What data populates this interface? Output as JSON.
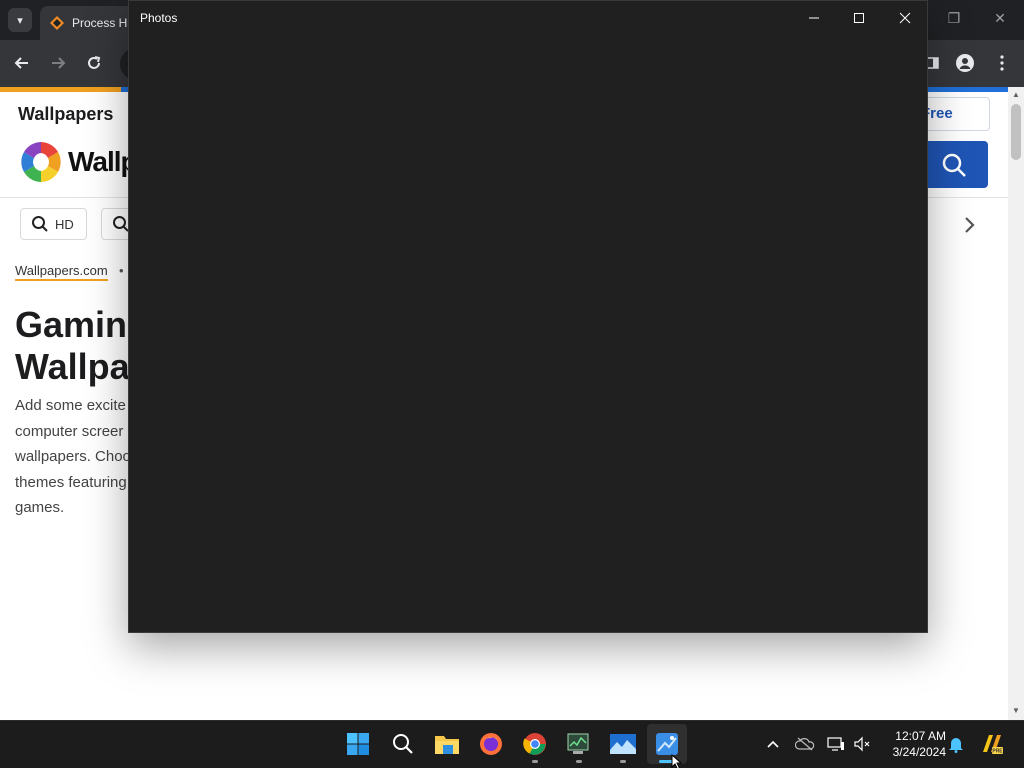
{
  "browser": {
    "tab_title": "Process Ha",
    "site": {
      "name": "Wallpapers",
      "wordmark": "Wallp",
      "join_label": "Free",
      "chips": [
        "HD",
        ""
      ],
      "breadcrumb": "Wallpapers.com",
      "breadcrumb_sep": "•",
      "title_line1": "Gamin",
      "title_line2": "Wallpa",
      "description": [
        "Add some excite",
        "computer screer",
        "wallpapers. Choo",
        "themes featuring",
        "games."
      ]
    }
  },
  "photos": {
    "title": "Photos"
  },
  "taskbar": {
    "apps": [
      {
        "icon": "windows-start-icon"
      },
      {
        "icon": "search-icon"
      },
      {
        "icon": "file-explorer-icon"
      },
      {
        "icon": "firefox-icon"
      },
      {
        "icon": "chrome-icon"
      },
      {
        "icon": "task-manager-icon"
      },
      {
        "icon": "photos-landscape-icon"
      },
      {
        "icon": "photos-app-icon",
        "active": true
      }
    ],
    "time": "12:07 AM",
    "date": "3/24/2024"
  },
  "colors": {
    "photos_bg": "#202020",
    "taskbar_bg": "#1c1c1c",
    "accent_blue": "#1f55b5",
    "accent_orange": "#f0a020"
  }
}
